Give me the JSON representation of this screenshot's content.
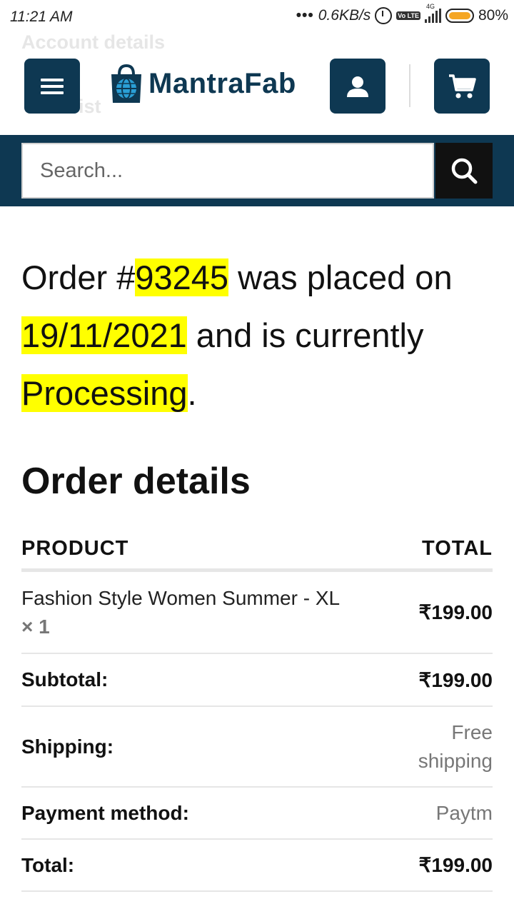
{
  "status_bar": {
    "time": "11:21 AM",
    "network_speed": "0.6KB/s",
    "network_type": "4G",
    "volte": "Vo LTE",
    "battery_percent": "80%",
    "battery_level": 0.8
  },
  "background_ghost": {
    "line1": "Account details",
    "line2": "ist"
  },
  "header": {
    "brand": "MantraFab",
    "icons": {
      "menu": "hamburger-menu-icon",
      "logo": "shopping-bag-globe-icon",
      "account": "user-icon",
      "cart": "cart-icon"
    },
    "brand_color": "#0e3852"
  },
  "search": {
    "placeholder": "Search...",
    "icon": "search-icon"
  },
  "order": {
    "prefix": "Order #",
    "number": "93245",
    "placed_text": " was placed on ",
    "date": "19/11/2021",
    "status_text": " and is currently ",
    "status": "Processing",
    "suffix": ".",
    "highlight_color": "#ffff00"
  },
  "order_details": {
    "heading": "Order details",
    "columns": [
      "PRODUCT",
      "TOTAL"
    ],
    "item": {
      "name": "Fashion Style Women Summer - XL",
      "quantity": " × 1",
      "total": "₹199.00"
    },
    "rows": [
      {
        "label": "Subtotal:",
        "value": "₹199.00"
      },
      {
        "label": "Shipping:",
        "value": "Free shipping"
      },
      {
        "label": "Payment method:",
        "value": "Paytm"
      },
      {
        "label": "Total:",
        "value": "₹199.00"
      }
    ]
  }
}
